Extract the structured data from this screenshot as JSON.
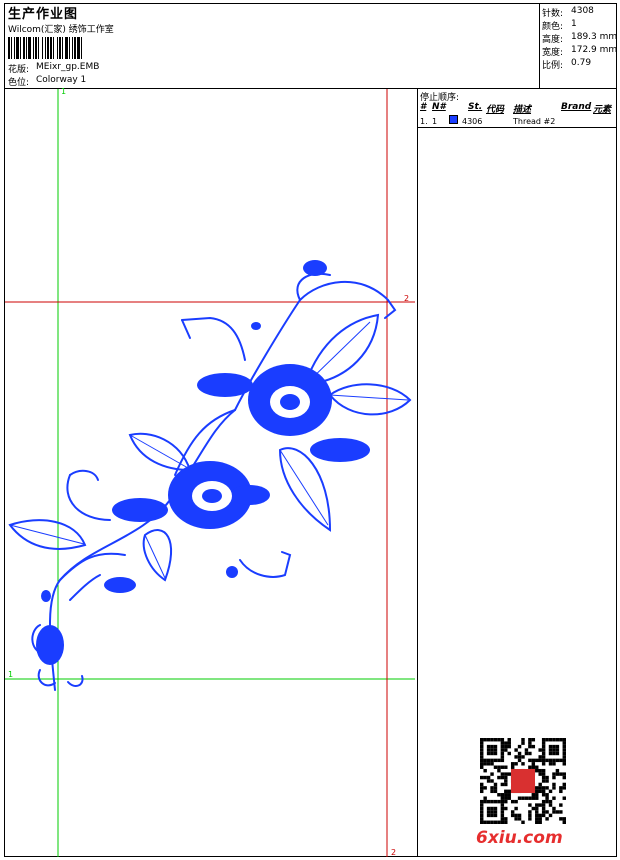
{
  "header": {
    "title": "生产作业图",
    "company": "Wilcom(汇家) 绣饰工作室",
    "pattern_label": "花版:",
    "pattern_value": "MEixr_gp.EMB",
    "color_label": "色位:",
    "color_value": "Colorway 1"
  },
  "stats": [
    {
      "label": "针数:",
      "value": "4308"
    },
    {
      "label": "颜色:",
      "value": "1"
    },
    {
      "label": "高度:",
      "value": "189.3 mm"
    },
    {
      "label": "宽度:",
      "value": "172.9 mm"
    },
    {
      "label": "比例:",
      "value": "0.79"
    }
  ],
  "stop_sequence": {
    "title": "停止顺序:",
    "columns": [
      "#",
      "N#",
      "St.",
      "代码",
      "描述",
      "Brand",
      "元素"
    ],
    "rows": [
      {
        "index": "1.",
        "n": "1",
        "code": "4306",
        "description": "Thread #2",
        "color": "#1a3dff"
      }
    ]
  },
  "guides": {
    "green_top": "1",
    "green_left": "1",
    "red_right": "2",
    "red_bottom": "2"
  },
  "colors": {
    "thread": "#1a3dff",
    "guide_green": "#00cc00",
    "guide_red": "#cc0000"
  },
  "watermark": {
    "site": "6xiu.com"
  }
}
